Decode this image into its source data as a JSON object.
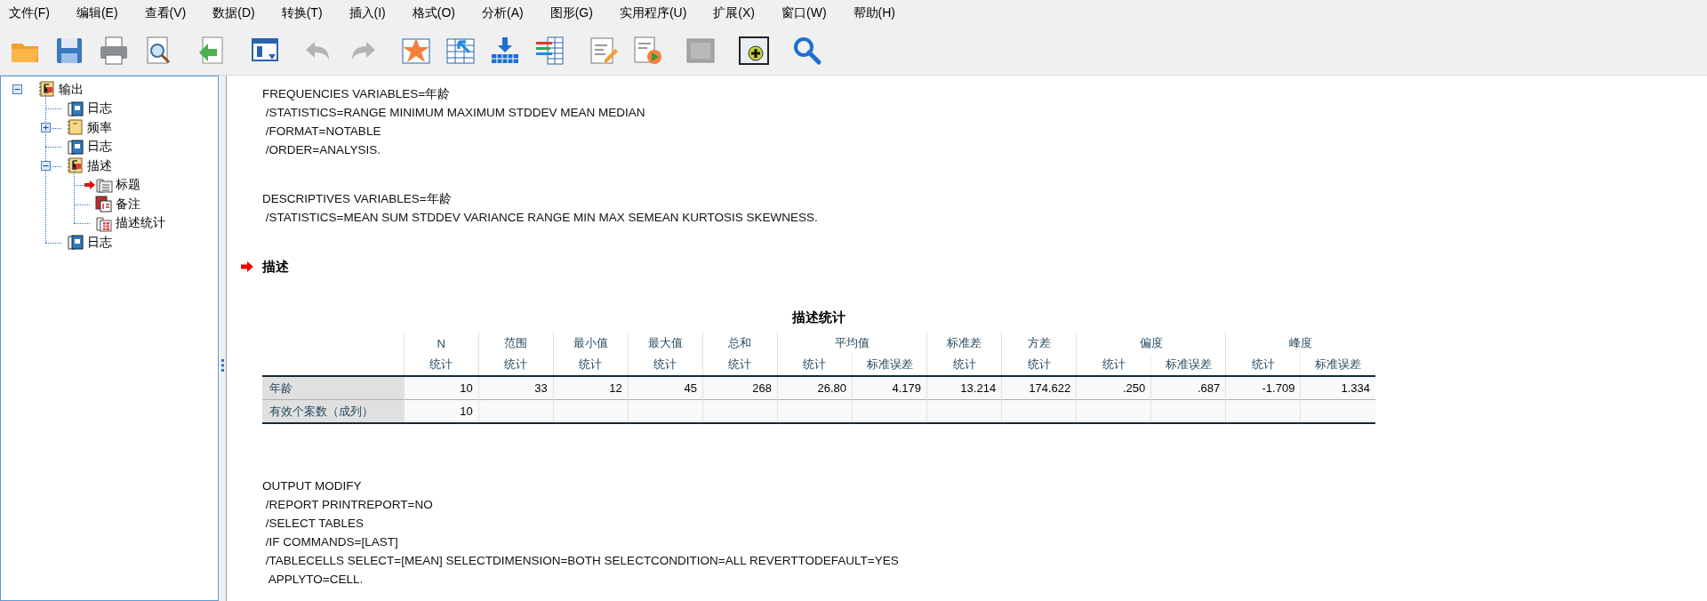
{
  "menu": [
    "文件(F)",
    "编辑(E)",
    "查看(V)",
    "数据(D)",
    "转换(T)",
    "插入(I)",
    "格式(O)",
    "分析(A)",
    "图形(G)",
    "实用程序(U)",
    "扩展(X)",
    "窗口(W)",
    "帮助(H)"
  ],
  "toolbar": [
    [
      {
        "kind": "open",
        "disabled": false
      },
      {
        "kind": "save",
        "disabled": false
      },
      {
        "kind": "print",
        "disabled": false
      },
      {
        "kind": "preview",
        "disabled": false
      }
    ],
    [
      {
        "kind": "recall",
        "disabled": false
      }
    ],
    [
      {
        "kind": "goto-data",
        "disabled": false
      }
    ],
    [
      {
        "kind": "undo",
        "disabled": true
      },
      {
        "kind": "redo",
        "disabled": true
      }
    ],
    [
      {
        "kind": "star",
        "disabled": false
      },
      {
        "kind": "goto-case",
        "disabled": false
      },
      {
        "kind": "insert-row",
        "disabled": false
      },
      {
        "kind": "variables",
        "disabled": false
      }
    ],
    [
      {
        "kind": "edit-doc",
        "disabled": false
      },
      {
        "kind": "run-doc",
        "disabled": false
      }
    ],
    [
      {
        "kind": "panel",
        "disabled": true
      }
    ],
    [
      {
        "kind": "add",
        "disabled": false
      }
    ],
    [
      {
        "kind": "search",
        "disabled": false
      }
    ]
  ],
  "tree": [
    {
      "label": "输出",
      "kind": "output",
      "expanded": true,
      "current": false,
      "children": [
        {
          "label": "日志",
          "kind": "log",
          "current": false
        },
        {
          "label": "频率",
          "kind": "frequencies",
          "expanded": false,
          "current": false
        },
        {
          "label": "日志",
          "kind": "log",
          "current": false
        },
        {
          "label": "描述",
          "kind": "output",
          "expanded": true,
          "current": false,
          "children": [
            {
              "label": "标题",
              "kind": "title",
              "current": true
            },
            {
              "label": "备注",
              "kind": "notes",
              "current": false
            },
            {
              "label": "描述统计",
              "kind": "table",
              "current": false
            }
          ]
        },
        {
          "label": "日志",
          "kind": "log",
          "current": false
        }
      ]
    }
  ],
  "content": [
    {
      "kind": "syntax",
      "lines": [
        "FREQUENCIES VARIABLES=年龄",
        " /STATISTICS=RANGE MINIMUM MAXIMUM STDDEV MEAN MEDIAN",
        " /FORMAT=NOTABLE",
        " /ORDER=ANALYSIS."
      ]
    },
    {
      "kind": "syntax",
      "lines": [
        "DESCRIPTIVES VARIABLES=年龄",
        " /STATISTICS=MEAN SUM STDDEV VARIANCE RANGE MIN MAX SEMEAN KURTOSIS SKEWNESS."
      ]
    },
    {
      "kind": "heading",
      "text": "描述",
      "current": true
    },
    {
      "kind": "table",
      "title": "描述统计",
      "columns": [
        {
          "label": "N"
        },
        {
          "label": "范围"
        },
        {
          "label": "最小值"
        },
        {
          "label": "最大值"
        },
        {
          "label": "总和"
        },
        {
          "label": "平均值",
          "colspan": 2
        },
        {
          "label": "标准差"
        },
        {
          "label": "方差"
        },
        {
          "label": "偏度",
          "colspan": 2
        },
        {
          "label": "峰度",
          "colspan": 2
        }
      ],
      "subheaders": [
        "统计",
        "统计",
        "统计",
        "统计",
        "统计",
        "统计",
        "标准误差",
        "统计",
        "统计",
        "统计",
        "标准误差",
        "统计",
        "标准误差"
      ],
      "rows": [
        {
          "label": "年龄",
          "cells": [
            "10",
            "33",
            "12",
            "45",
            "268",
            "26.80",
            "4.179",
            "13.214",
            "174.622",
            ".250",
            ".687",
            "-1.709",
            "1.334"
          ]
        },
        {
          "label": "有效个案数（成列）",
          "cells": [
            "10"
          ]
        }
      ]
    },
    {
      "kind": "syntax",
      "lines": [
        "OUTPUT MODIFY",
        " /REPORT PRINTREPORT=NO",
        " /SELECT TABLES",
        " /IF COMMANDS=[LAST]",
        " /TABLECELLS SELECT=[MEAN] SELECTDIMENSION=BOTH SELECTCONDITION=ALL REVERTTODEFAULT=YES",
        "  APPLYTO=CELL."
      ]
    }
  ]
}
